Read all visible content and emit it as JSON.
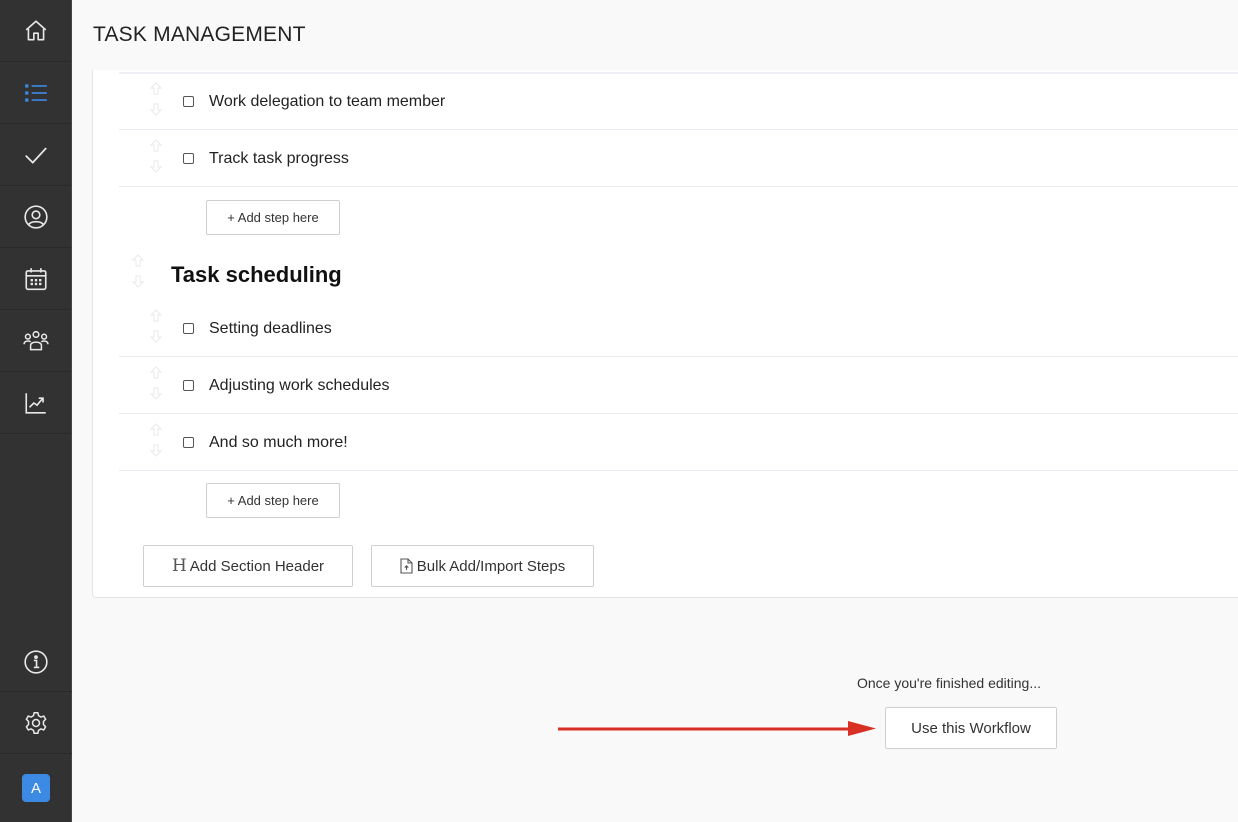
{
  "sidebar": {
    "items": [
      {
        "name": "home",
        "icon": "home-icon",
        "active": false
      },
      {
        "name": "list",
        "icon": "list-icon",
        "active": true
      },
      {
        "name": "tasks",
        "icon": "checkmark-icon",
        "active": false
      },
      {
        "name": "profile",
        "icon": "user-circle-icon",
        "active": false
      },
      {
        "name": "calendar",
        "icon": "calendar-icon",
        "active": false
      },
      {
        "name": "team",
        "icon": "users-icon",
        "active": false
      },
      {
        "name": "reports",
        "icon": "trending-chart-icon",
        "active": false
      }
    ],
    "bottom": [
      {
        "name": "info",
        "icon": "info-icon"
      },
      {
        "name": "settings",
        "icon": "gear-icon"
      }
    ],
    "avatar_letter": "A",
    "accent_color": "#3d8ae5"
  },
  "header": {
    "title": "TASK MANAGEMENT"
  },
  "workflow": {
    "steps_top": [
      {
        "label": "Work delegation to team member",
        "checked": false
      },
      {
        "label": "Track task progress",
        "checked": false
      }
    ],
    "add_step_label": "+ Add step here",
    "sections": [
      {
        "title": "Task scheduling",
        "steps": [
          {
            "label": "Setting deadlines",
            "checked": false
          },
          {
            "label": "Adjusting work schedules",
            "checked": false
          },
          {
            "label": "And so much more!",
            "checked": false
          }
        ]
      }
    ],
    "add_section_header_label": "Add Section Header",
    "bulk_add_label": "Bulk Add/Import Steps"
  },
  "footer": {
    "note": "Once you're finished editing...",
    "use_workflow_label": "Use this Workflow",
    "annotation_arrow_color": "#d93025"
  }
}
